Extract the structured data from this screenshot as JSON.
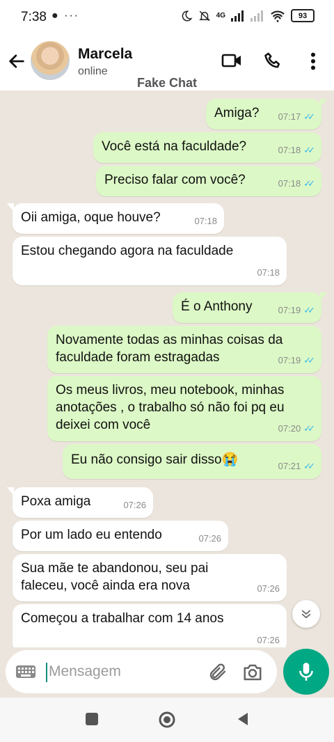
{
  "status_bar": {
    "time": "7:38",
    "left_icons": "● ···",
    "network": "4G",
    "battery": "93"
  },
  "header": {
    "name": "Marcela",
    "presence": "online",
    "watermark": "Fake Chat"
  },
  "messages": [
    {
      "dir": "out",
      "text": "Amiga?",
      "time": "07:17",
      "read": true
    },
    {
      "dir": "out",
      "text": "Você está na faculdade?",
      "time": "07:18",
      "read": true
    },
    {
      "dir": "out",
      "text": "Preciso falar com você?",
      "time": "07:18",
      "read": true
    },
    {
      "dir": "in",
      "text": "Oii amiga, oque houve?",
      "time": "07:18"
    },
    {
      "dir": "in",
      "text": "Estou chegando agora na faculdade",
      "time": "07:18"
    },
    {
      "dir": "out",
      "text": "É o Anthony",
      "time": "07:19",
      "read": true
    },
    {
      "dir": "out",
      "text": "Novamente todas as minhas coisas da faculdade foram estragadas",
      "time": "07:19",
      "read": true
    },
    {
      "dir": "out",
      "text": "Os meus livros, meu notebook, minhas anotações , o trabalho só não foi pq eu deixei com você",
      "time": "07:20",
      "read": true
    },
    {
      "dir": "out",
      "text": "Eu não consigo sair disso😭",
      "time": "07:21",
      "read": true
    },
    {
      "dir": "in",
      "text": "Poxa amiga",
      "time": "07:26"
    },
    {
      "dir": "in",
      "text": "Por um lado eu entendo",
      "time": "07:26"
    },
    {
      "dir": "in",
      "text": "Sua mãe te abandonou, seu pai faleceu, você ainda era nova",
      "time": "07:26"
    },
    {
      "dir": "in",
      "text": "Começou a trabalhar com 14 anos",
      "time": "07:26"
    }
  ],
  "input": {
    "placeholder": "Mensagem"
  },
  "colors": {
    "outgoing_bubble": "#dcf8c6",
    "incoming_bubble": "#ffffff",
    "chat_background": "#ece5dd",
    "accent": "#00a884",
    "read_ticks": "#34b7f1"
  },
  "icons": {
    "header": [
      "back-arrow-icon",
      "video-call-icon",
      "phone-icon",
      "more-vert-icon"
    ],
    "input": [
      "keyboard-icon",
      "attach-icon",
      "camera-icon",
      "mic-icon"
    ],
    "nav": [
      "recent-apps-icon",
      "home-icon",
      "back-icon"
    ]
  }
}
